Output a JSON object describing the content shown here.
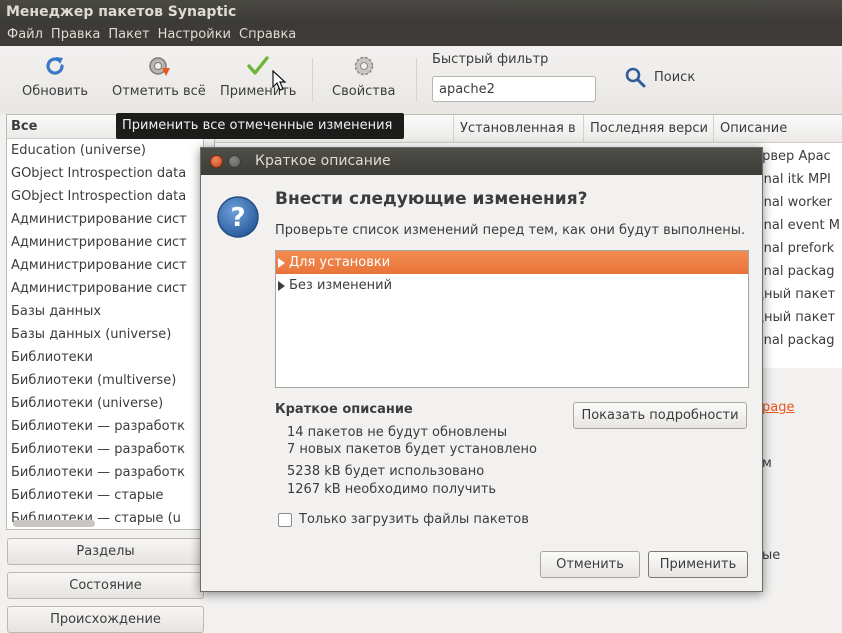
{
  "window": {
    "title": "Менеджер пакетов Synaptic"
  },
  "menu": [
    "Файл",
    "Правка",
    "Пакет",
    "Настройки",
    "Справка"
  ],
  "toolbar": {
    "reload": "Обновить",
    "mark_all": "Отметить всё",
    "apply": "Применить",
    "properties": "Свойства",
    "quick_filter_label": "Быстрый фильтр",
    "quick_filter_value": "apache2",
    "search": "Поиск"
  },
  "tooltip": "Применить все отмеченные изменения",
  "sections": {
    "header": "Все",
    "items": [
      "Education (universe)",
      "GObject Introspection data",
      "GObject Introspection data",
      "Администрирование сист",
      "Администрирование сист",
      "Администрирование сист",
      "Администрирование сист",
      "Базы данных",
      "Базы данных (universe)",
      "Библиотеки",
      "Библиотеки (multiverse)",
      "Библиотеки (universe)",
      "Библиотеки — разработк",
      "Библиотеки — разработк",
      "Библиотеки — разработк",
      "Библиотеки — старые",
      "Библиотеки — старые (u"
    ]
  },
  "side_buttons": [
    "Разделы",
    "Состояние",
    "Происхождение"
  ],
  "packages": {
    "columns": [
      "Установленная в",
      "Последняя верси",
      "Описание"
    ],
    "descriptions": [
      "сервер Apac",
      "tional itk MPI",
      "tional worker",
      "tional event M",
      "tional prefork",
      "tional packag",
      "одный пакет",
      "одный пакет",
      "tional packag",
      "...."
    ]
  },
  "details": {
    "link": "page",
    "line1": "м",
    "line2": "ые"
  },
  "dialog": {
    "title": "Краткое описание",
    "heading": "Внести следующие изменения?",
    "subtitle": "Проверьте список изменений перед тем, как они будут выполнены.",
    "changes": [
      {
        "label": "Для установки",
        "selected": true
      },
      {
        "label": "Без изменений",
        "selected": false
      }
    ],
    "summary_title": "Краткое описание",
    "summary_lines": [
      "14 пакетов не будут обновлены",
      "7 новых пакетов будет установлено",
      "5238 kB будет использовано",
      "1267 kB необходимо получить"
    ],
    "show_details": "Показать подробности",
    "download_only": "Только загрузить файлы пакетов",
    "cancel": "Отменить",
    "apply": "Применить"
  },
  "colors": {
    "accent": "#f07746",
    "titlebar": "#3c3b37",
    "tooltip_bg": "#1c1c1b"
  }
}
